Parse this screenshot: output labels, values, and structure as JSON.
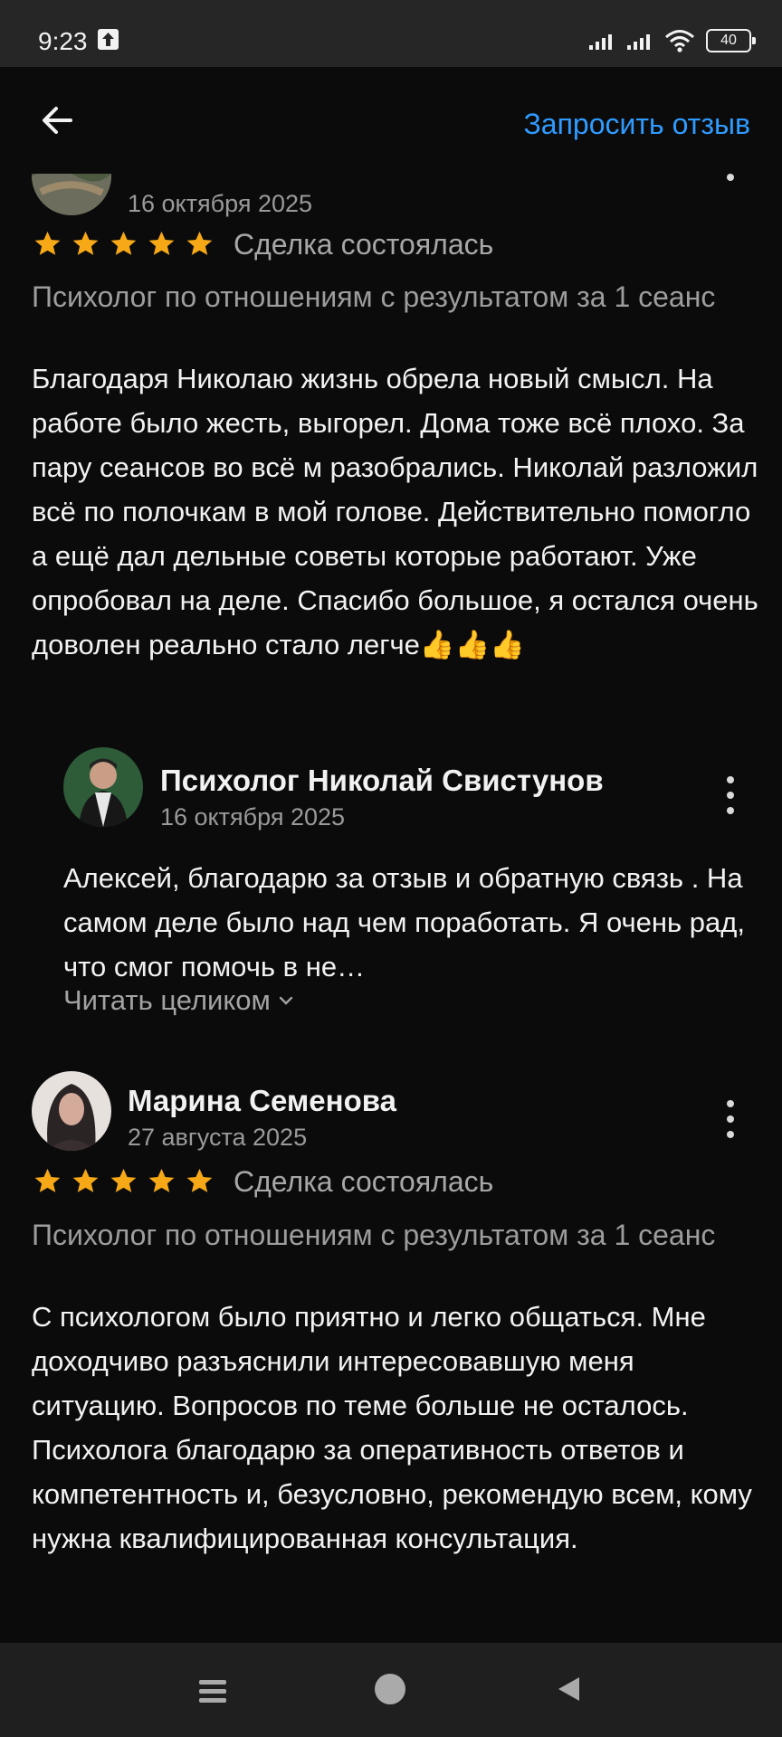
{
  "status_bar": {
    "time": "9:23",
    "battery": "40",
    "icons": [
      "upload-icon",
      "signal-icon",
      "signal-icon",
      "wifi-icon",
      "battery-icon"
    ]
  },
  "header": {
    "back_icon": "arrow-left-icon",
    "request_review": "Запросить отзыв"
  },
  "reviews": [
    {
      "date": "16 октября 2025",
      "rating": 5,
      "deal_status": "Сделка состоялась",
      "topic": "Психолог по отношениям с результатом за 1 сеанс",
      "text": "Благодаря Николаю жизнь обрела новый смысл. На работе было жесть, выгорел. Дома тоже всё плохо. За пару сеансов во всё м разобрались. Николай разложил всё по полочкам в мой голове. Действительно помогло а ещё дал дельные советы которые работают. Уже опробовал на деле. Спасибо большое, я остался очень доволен реально стало легче👍👍👍",
      "reply": {
        "author": "Психолог Николай Свистунов",
        "date": "16 октября 2025",
        "text": "Алексей, благодарю за отзыв и   обратную связь . На самом деле было над чем поработать. Я очень рад, что смог помочь в не…",
        "read_more": "Читать целиком"
      }
    },
    {
      "author": "Марина Семенова",
      "date": "27 августа 2025",
      "rating": 5,
      "deal_status": "Сделка состоялась",
      "topic": "Психолог по отношениям с результатом за 1 сеанс",
      "text": "С психологом было приятно и легко общаться. Мне доходчиво разъяснили интересовавшую меня ситуацию. Вопросов по теме больше не осталось. Психолога благодарю за оперативность ответов и компетентность и, безусловно, рекомендую всем, кому нужна квалифицированная консультация."
    }
  ],
  "nav": {
    "menu_icon": "menu-icon",
    "home_icon": "home-icon",
    "back_icon": "triangle-back-icon"
  },
  "colors": {
    "background": "#0b0b0c",
    "accent": "#2f9bff",
    "star": "#f6a817"
  }
}
